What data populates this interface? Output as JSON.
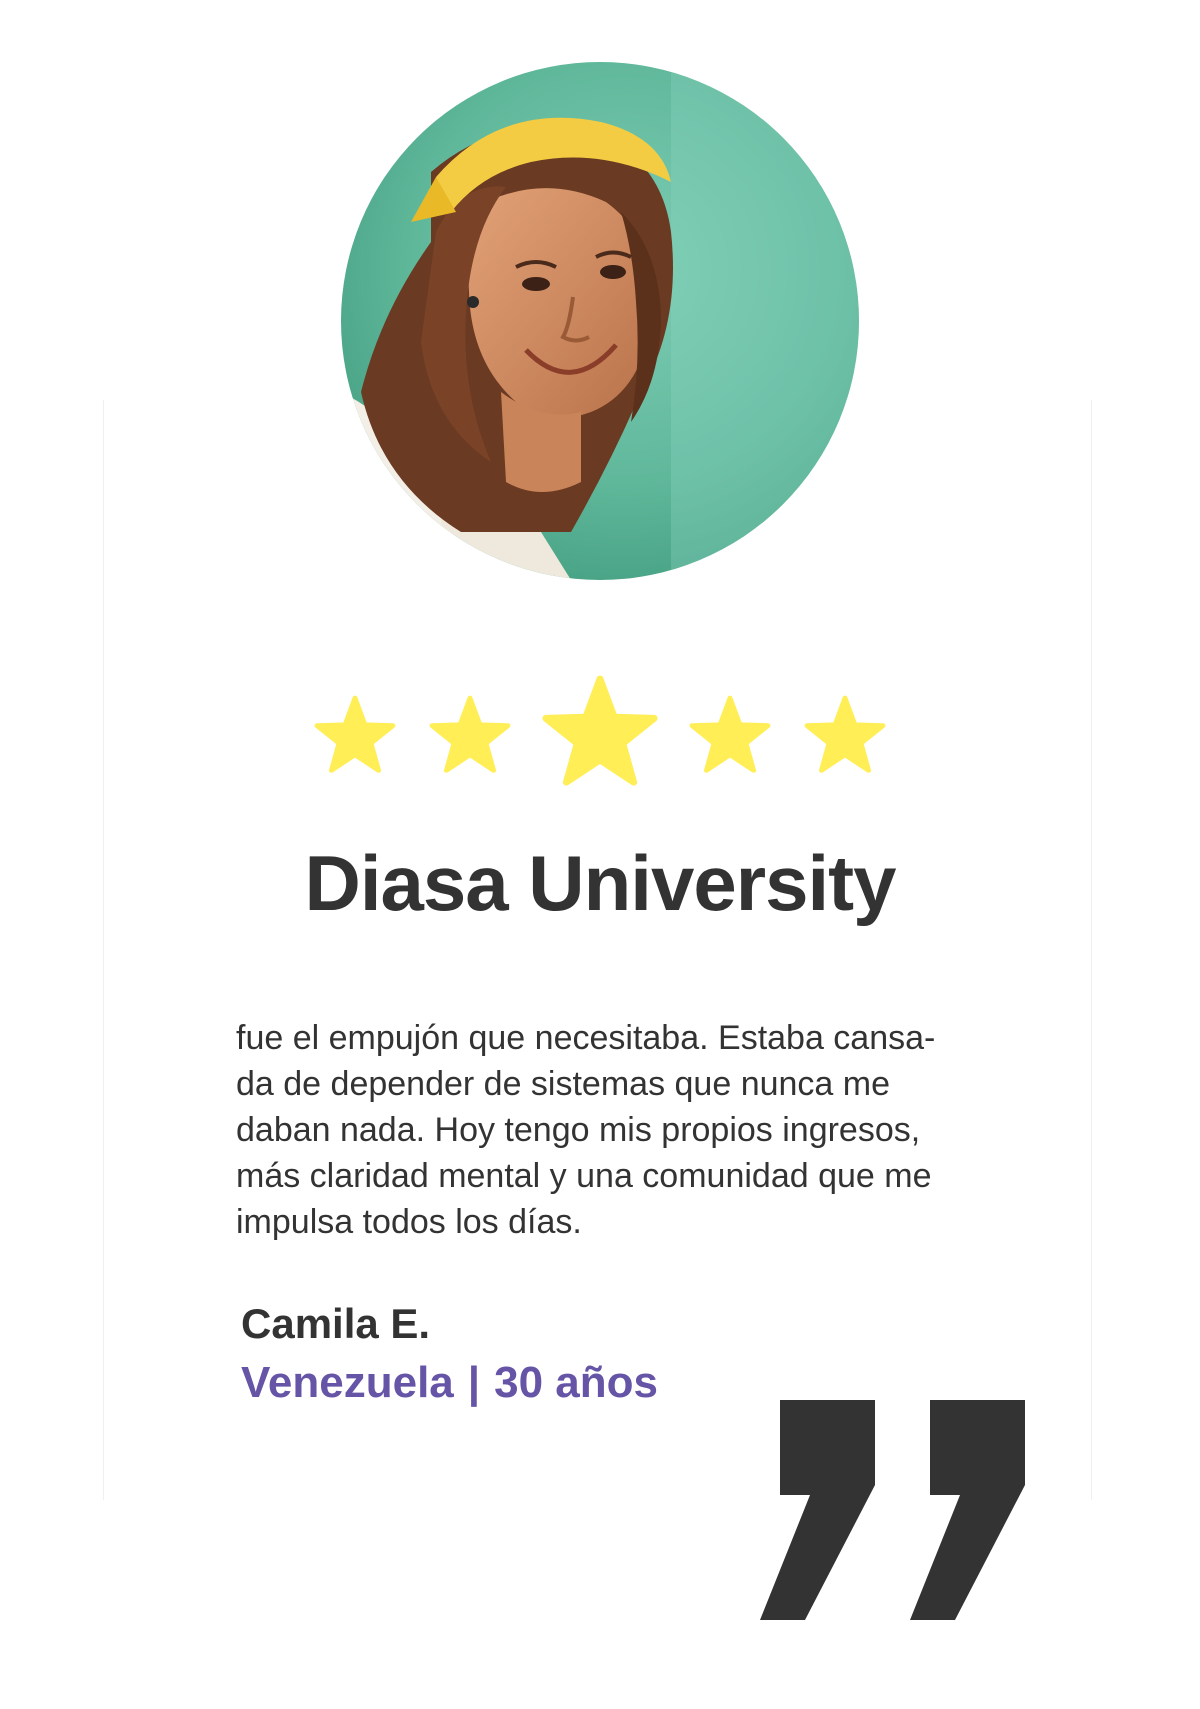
{
  "rating": {
    "value": 5,
    "max": 5,
    "color": "#FFEE55"
  },
  "title": "Diasa University",
  "testimonial": {
    "lines": [
      "fue el empujón que necesitaba. Estaba cansa-",
      "da de depender de sistemas que nunca me",
      "daban nada. Hoy tengo mis propios ingresos,",
      "más claridad mental y una comunidad que me",
      "impulsa todos los días."
    ]
  },
  "author": {
    "name": "Camila E.",
    "country": "Venezuela",
    "separator": "|",
    "age": "30 años"
  },
  "colors": {
    "text": "#333333",
    "accent": "#6654A6",
    "photo_background": "#5FB79A"
  },
  "icons": {
    "quote": "closing-quote-icon",
    "star": "star-icon"
  }
}
